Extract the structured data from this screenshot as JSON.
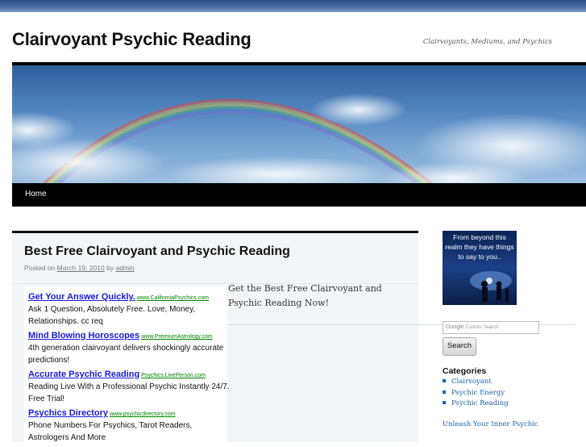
{
  "header": {
    "site_title": "Clairvoyant Psychic Reading",
    "site_description": "Clairvoyants, Mediums, and Psychics"
  },
  "nav": {
    "home_label": "Home"
  },
  "post": {
    "title": "Best Free Clairvoyant and Psychic Reading",
    "meta_prefix": "Posted on",
    "date": "March 19, 2010",
    "meta_by": "by",
    "author": "admin",
    "body_text": "Get the Best Free Clairvoyant and Psychic Reading Now!"
  },
  "ads": [
    {
      "headline": "Get Your Answer Quickly.",
      "url": "www.CaliforniaPsychics.com",
      "body": "Ask 1 Question, Absolutely Free. Love, Money, Relationships. cc req"
    },
    {
      "headline": "Mind Blowing Horoscopes",
      "url": "www.PremiumAstrology.com",
      "body": "4th generation clairvoyant delivers shockingly accurate predictions!"
    },
    {
      "headline": "Accurate Psychic Reading",
      "url": "Psychics.LivePerson.com",
      "body": "Reading Live With a Professional Psychic Instantly 24/7. Free Trial!"
    },
    {
      "headline": "Psychics Directory",
      "url": "www.psychicdirectory.com",
      "body": "Phone Numbers For Psychics, Tarot Readers, Astrologers And More"
    }
  ],
  "sidebar": {
    "image_text": "From beyond this realm they have things to say to you..",
    "search_placeholder": "Custom Search",
    "search_button": "Search",
    "categories_title": "Categories",
    "categories": [
      "Clairvoyant",
      "Psychic Energy",
      "Psychic Reading"
    ],
    "unleash_link": "Unleash Your Inner Psychic"
  },
  "colors": {
    "nav_bg": "#000000",
    "link_blue": "#1b62a8",
    "ad_headline": "#1a1adc",
    "ad_url": "#008000",
    "post_bg": "#f3f6f9"
  }
}
